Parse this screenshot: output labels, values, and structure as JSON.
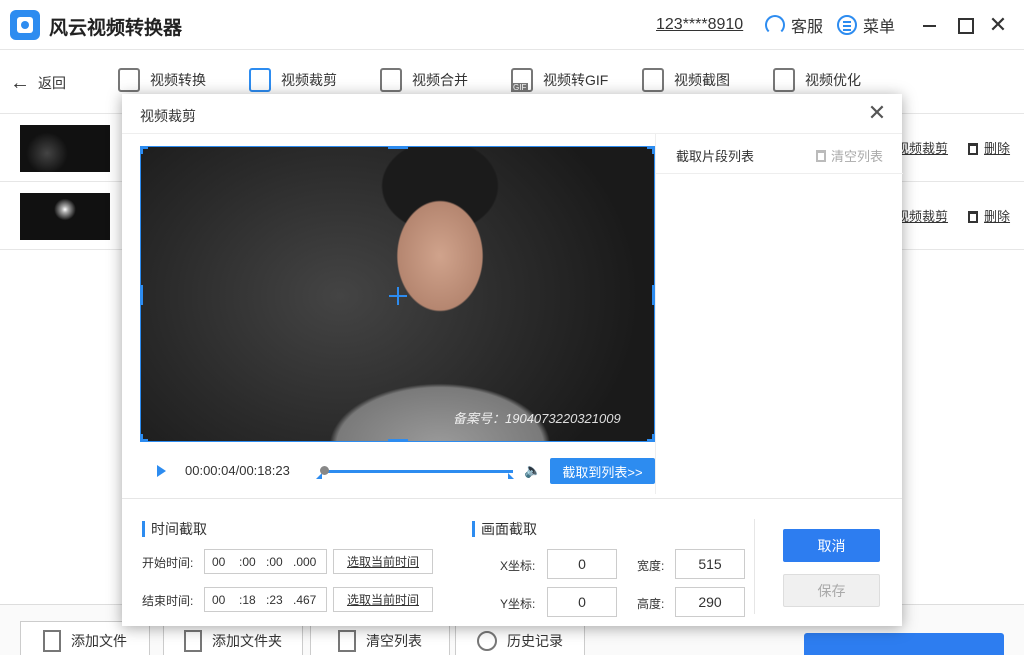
{
  "app": {
    "title": "风云视频转换器",
    "account": "123****8910",
    "service": "客服",
    "menu": "菜单"
  },
  "toolbar": {
    "back": "返回",
    "tools": [
      {
        "label": "视频转换",
        "icon": "video-convert-icon"
      },
      {
        "label": "视频裁剪",
        "icon": "video-crop-icon"
      },
      {
        "label": "视频合并",
        "icon": "video-merge-icon"
      },
      {
        "label": "视频转GIF",
        "icon": "gif-icon"
      },
      {
        "label": "视频截图",
        "icon": "screenshot-icon"
      },
      {
        "label": "视频优化",
        "icon": "optimize-icon"
      }
    ]
  },
  "files": [
    {
      "crop": "视频裁剪",
      "delete": "删除"
    },
    {
      "crop": "视频裁剪",
      "delete": "删除"
    }
  ],
  "bottom": {
    "add_file": "添加文件",
    "add_folder": "添加文件夹",
    "clear_list": "清空列表",
    "history": "历史记录"
  },
  "dialog": {
    "title": "视频裁剪",
    "watermark": "备案号：1904073220321009",
    "clip_list_title": "截取片段列表",
    "clear_list": "清空列表",
    "current_time": "00:00:04/00:18:23",
    "progress": 0.004,
    "add_to_list": "截取到列表>>",
    "time_section": "时间截取",
    "start_label": "开始时间:",
    "end_label": "结束时间:",
    "start": {
      "h": "00",
      "m": ":00",
      "s": ":00",
      "ms": ".000"
    },
    "end": {
      "h": "00",
      "m": ":18",
      "s": ":23",
      "ms": ".467"
    },
    "pick_current": "选取当前时间",
    "frame_section": "画面截取",
    "x_label": "X坐标:",
    "y_label": "Y坐标:",
    "w_label": "宽度:",
    "h_label": "高度:",
    "x": "0",
    "y": "0",
    "width": "515",
    "height": "290",
    "cancel": "取消",
    "save": "保存"
  }
}
